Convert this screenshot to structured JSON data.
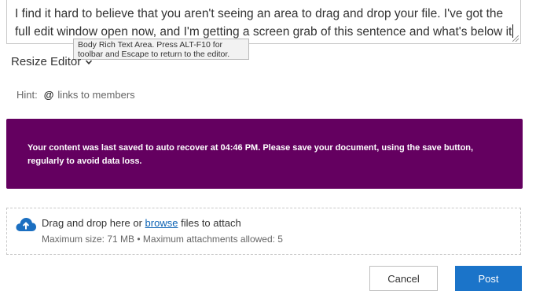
{
  "editor": {
    "text": "I find it hard to believe that you aren't seeing an area to drag and drop your file. I've got the full edit window open now, and I'm getting a screen grab of this sentence and what's below it",
    "tooltip": "Body Rich Text Area. Press ALT-F10 for toolbar and Escape to return to the editor."
  },
  "resize_editor": {
    "label": "Resize Editor"
  },
  "hint": {
    "label": "Hint:",
    "symbol": "@",
    "text": "links to members"
  },
  "autosave_banner": {
    "message": "Your content was last saved to auto recover at 04:46 PM. Please save your document, using the save button, regularly to avoid data loss.",
    "color": "#640060"
  },
  "attachments": {
    "prefix": "Drag and drop here or",
    "browse_link": "browse",
    "suffix": "files to attach",
    "limits": "Maximum size: 71 MB • Maximum attachments allowed: 5",
    "icon": "cloud-upload-icon",
    "icon_color": "#1b6fc1"
  },
  "actions": {
    "cancel_label": "Cancel",
    "post_label": "Post",
    "post_color": "#1b74c9"
  }
}
